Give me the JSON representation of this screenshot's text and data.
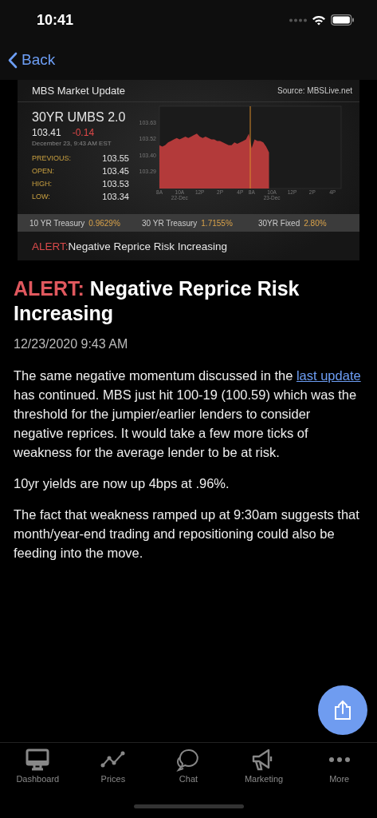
{
  "status_bar": {
    "time": "10:41"
  },
  "nav": {
    "back": "Back"
  },
  "market_card": {
    "title": "MBS Market Update",
    "source": "Source: MBSLive.net",
    "instrument": "30YR UMBS 2.0",
    "price": "103.41",
    "change": "-0.14",
    "timestamp": "December 23, 9:43 AM EST",
    "stats": [
      {
        "label": "PREVIOUS:",
        "value": "103.55"
      },
      {
        "label": "OPEN:",
        "value": "103.45"
      },
      {
        "label": "HIGH:",
        "value": "103.53"
      },
      {
        "label": "LOW:",
        "value": "103.34"
      }
    ],
    "chart_data": {
      "type": "area",
      "ylim": [
        103.17,
        103.74
      ],
      "yticks": [
        {
          "value": 103.29,
          "label": "103.29"
        },
        {
          "value": 103.4,
          "label": "103.40"
        },
        {
          "value": 103.52,
          "label": "103.52"
        },
        {
          "value": 103.63,
          "label": "103.63"
        }
      ],
      "categories": [
        "8A",
        null,
        null,
        null,
        null,
        null,
        null,
        "10A",
        null,
        null,
        null,
        null,
        null,
        null,
        "12P",
        null,
        null,
        null,
        null,
        null,
        null,
        "2P",
        null,
        null,
        null,
        null,
        null,
        null,
        "4P",
        null,
        null,
        null,
        "8A",
        null,
        null,
        null,
        null,
        null,
        null,
        "10A",
        null,
        null,
        null,
        null,
        null,
        null,
        "12P",
        null,
        null,
        null,
        null,
        null,
        null,
        "2P",
        null,
        null,
        null,
        null,
        null,
        null,
        "4P",
        null,
        null,
        null
      ],
      "series": [
        {
          "color": "#b33a3a",
          "values": [
            103.47,
            103.46,
            103.47,
            103.49,
            103.5,
            103.51,
            103.52,
            103.51,
            103.52,
            103.53,
            103.52,
            103.53,
            103.54,
            103.55,
            103.53,
            103.52,
            103.53,
            103.52,
            103.51,
            103.51,
            103.5,
            103.5,
            103.49,
            103.48,
            103.47,
            103.47,
            103.49,
            103.48,
            103.49,
            103.5,
            103.51,
            103.55,
            103.45,
            103.51,
            103.5,
            103.5,
            103.49,
            103.46,
            103.42,
            null,
            null,
            null,
            null,
            null,
            null,
            null,
            null,
            null,
            null,
            null,
            null,
            null,
            null,
            null,
            null,
            null,
            null,
            null,
            null,
            null,
            null,
            null,
            null,
            null
          ]
        }
      ]
    },
    "dates": [
      "22-Dec",
      "23-Dec"
    ],
    "rates": [
      {
        "label": "10 YR Treasury",
        "value": "0.9629%"
      },
      {
        "label": "30 YR Treasury",
        "value": "1.7155%"
      },
      {
        "label": "30YR Fixed",
        "value": "2.80%"
      }
    ],
    "alert": {
      "tag": "ALERT:",
      "text": "Negative Reprice Risk Increasing"
    }
  },
  "article": {
    "tag": "ALERT:",
    "headline": "Negative Reprice Risk Increasing",
    "date": "12/23/2020 9:43 AM",
    "paragraphs": [
      {
        "before": "The same negative momentum discussed in the ",
        "link": "last update",
        "after": " has continued.  MBS just hit 100-19 (100.59) which was the threshold for the jumpier/earlier lenders to consider negative reprices.  It would take a few more ticks of weakness for the average lender to be at risk."
      },
      {
        "before": "10yr yields are now up 4bps at .96%."
      },
      {
        "before": "The fact that weakness ramped up at 9:30am suggests that month/year-end trading and repositioning could also be feeding into the move."
      }
    ]
  },
  "tabs": [
    {
      "label": "Dashboard",
      "kind": "monitor"
    },
    {
      "label": "Prices",
      "kind": "linechart"
    },
    {
      "label": "Chat",
      "kind": "chat"
    },
    {
      "label": "Marketing",
      "kind": "megaphone"
    },
    {
      "label": "More",
      "kind": "dots"
    }
  ]
}
